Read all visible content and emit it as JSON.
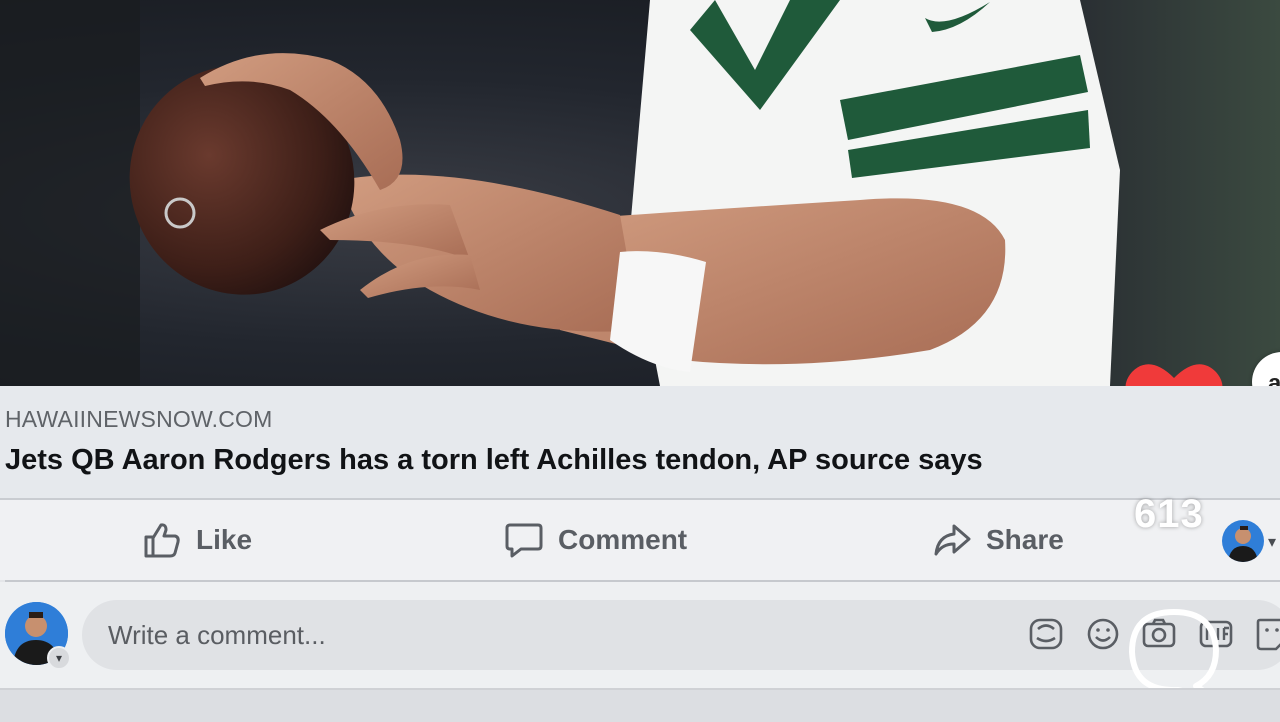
{
  "post": {
    "link_preview": {
      "domain": "HAWAIINEWSNOW.COM",
      "title": "Jets QB Aaron Rodgers has a torn left Achilles tendon, AP source says"
    },
    "actions": {
      "like_label": "Like",
      "comment_label": "Comment",
      "share_label": "Share"
    },
    "composer": {
      "placeholder": "Write a comment..."
    },
    "icons": {
      "like": "thumbs-up-icon",
      "comment": "speech-bubble-icon",
      "share": "share-arrow-icon",
      "avatar_sticker": "avatar-sticker-icon",
      "emoji": "smiley-icon",
      "camera": "camera-icon",
      "gif": "gif-icon",
      "sticker": "sticker-icon"
    }
  },
  "overlay": {
    "reaction_count": "613",
    "heart_color": "#f03a3a",
    "side_badge_letter": "a"
  },
  "colors": {
    "jersey_green": "#1f5a3a",
    "action_text": "#5a5e64"
  }
}
